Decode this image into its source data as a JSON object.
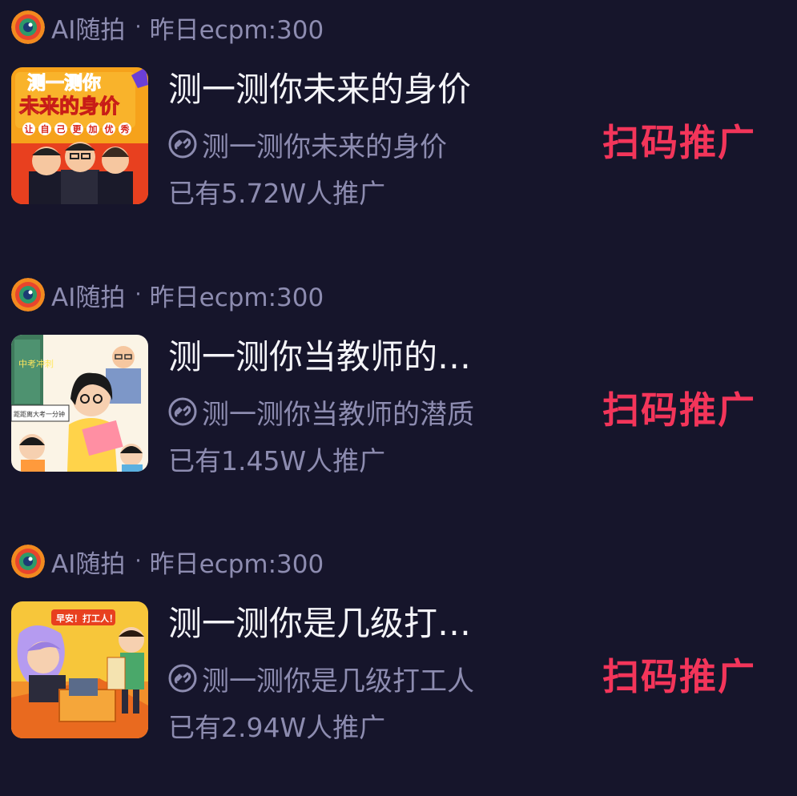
{
  "items": [
    {
      "source_name": "AI随拍",
      "separator": "·",
      "stat": "昨日ecpm:300",
      "title": "测一测你未来的身价",
      "link_text": "测一测你未来的身价",
      "count_text": "已有5.72W人推广",
      "action_label": "扫码推广",
      "thumb": {
        "line1": "测一测你",
        "line2": "未来的身价",
        "badges": [
          "让",
          "自",
          "己",
          "更",
          "加",
          "优",
          "秀"
        ]
      }
    },
    {
      "source_name": "AI随拍",
      "separator": "·",
      "stat": "昨日ecpm:300",
      "title": "测一测你当教师的…",
      "link_text": "测一测你当教师的潜质",
      "count_text": "已有1.45W人推广",
      "action_label": "扫码推广",
      "thumb": {
        "banner": "中考冲刺",
        "board": "距距离大考一分钟"
      }
    },
    {
      "source_name": "AI随拍",
      "separator": "·",
      "stat": "昨日ecpm:300",
      "title": "测一测你是几级打…",
      "link_text": "测一测你是几级打工人",
      "count_text": "已有2.94W人推广",
      "action_label": "扫码推广",
      "thumb": {
        "banner": "早安！打工人！"
      }
    }
  ],
  "colors": {
    "background": "#16152b",
    "secondary_text": "#8d8cb0",
    "title_text": "#f4f4f8",
    "accent": "#f3355a"
  },
  "icons": {
    "source_logo": "ai-camera-logo-icon",
    "link": "link-chain-icon"
  }
}
